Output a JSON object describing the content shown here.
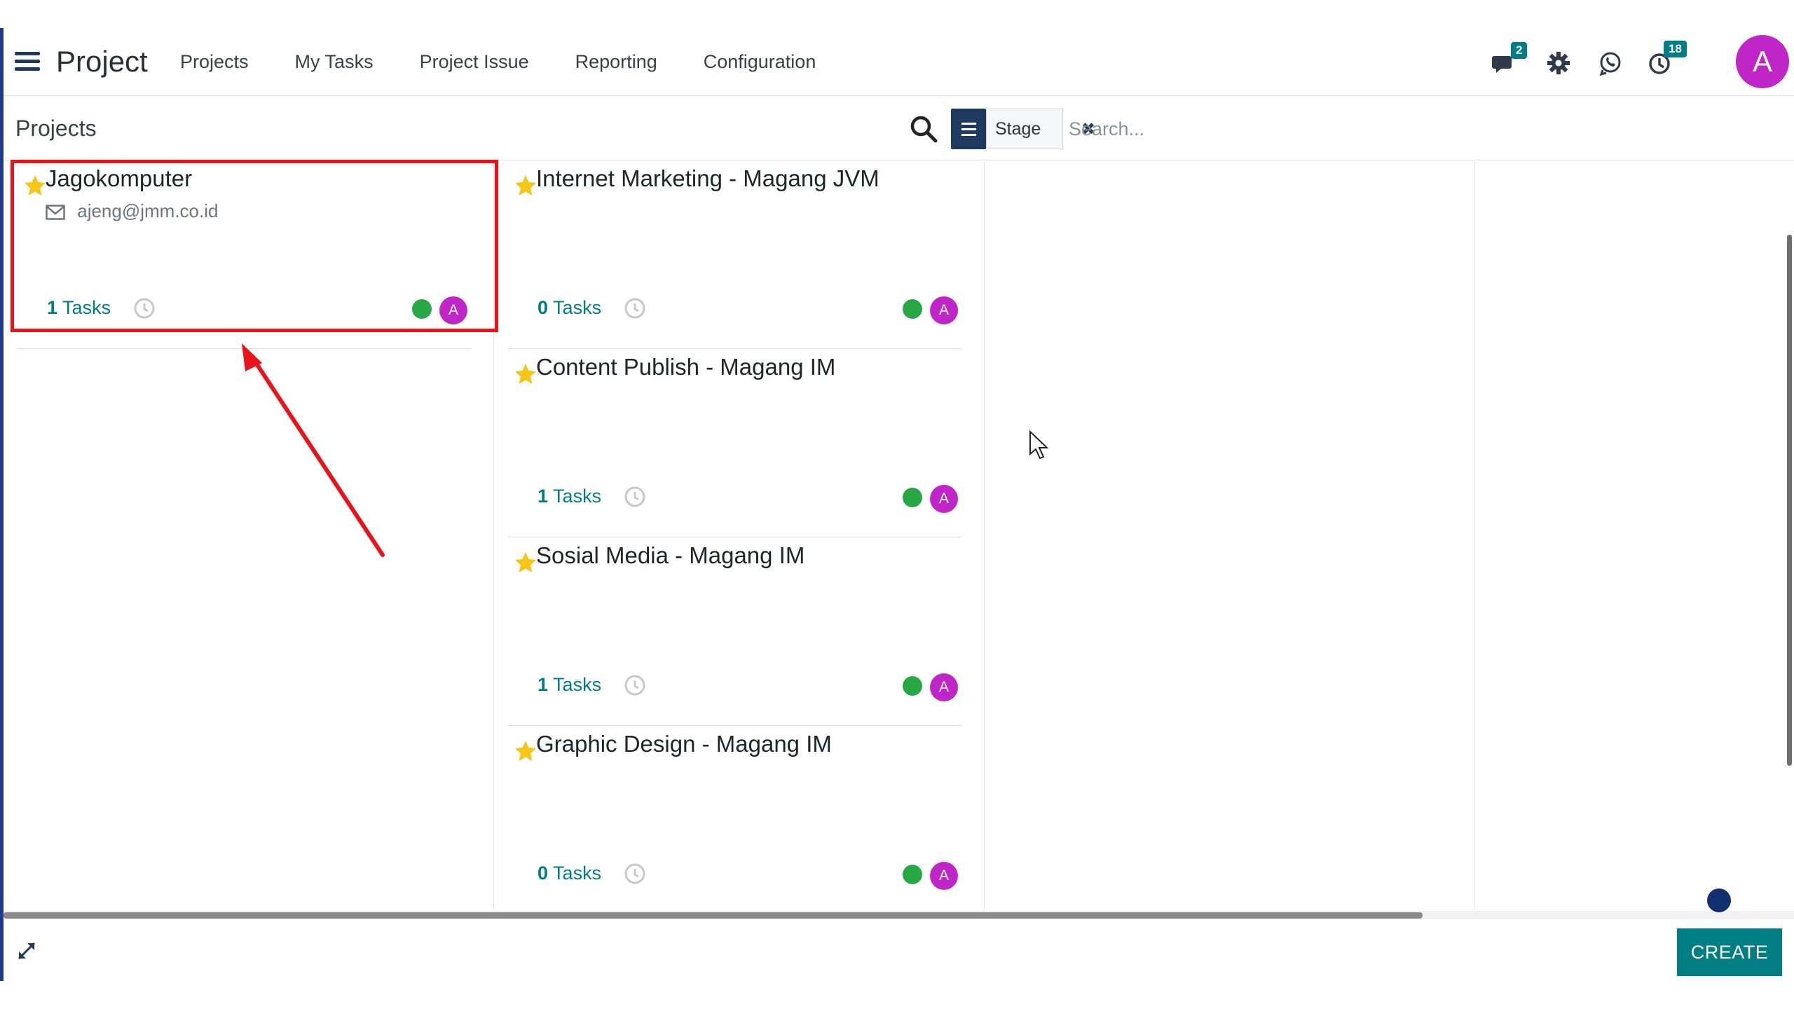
{
  "navbar": {
    "app_title": "Project",
    "menu": [
      "Projects",
      "My Tasks",
      "Project Issue",
      "Reporting",
      "Configuration"
    ],
    "messages_badge": "2",
    "activities_badge": "18",
    "user_initial": "A"
  },
  "control": {
    "breadcrumb": "Projects",
    "facet_label": "Stage",
    "search_placeholder": "Search..."
  },
  "columns": [
    {
      "cards": [
        {
          "title": "Jagokomputer",
          "email": "ajeng@jmm.co.id",
          "task_count": "1",
          "task_label": "Tasks",
          "user_initial": "A"
        }
      ]
    },
    {
      "cards": [
        {
          "title": "Internet Marketing - Magang JVM",
          "task_count": "0",
          "task_label": "Tasks",
          "user_initial": "A"
        },
        {
          "title": "Content Publish - Magang IM",
          "task_count": "1",
          "task_label": "Tasks",
          "user_initial": "A"
        },
        {
          "title": "Sosial Media - Magang IM",
          "task_count": "1",
          "task_label": "Tasks",
          "user_initial": "A"
        },
        {
          "title": "Graphic Design - Magang IM",
          "task_count": "0",
          "task_label": "Tasks",
          "user_initial": "A"
        }
      ]
    },
    {
      "cards": []
    },
    {
      "cards": []
    }
  ],
  "footer": {
    "create_label": "CREATE"
  },
  "colors": {
    "accent": "#017e84",
    "navy": "#1f3a5f",
    "avatar": "#c026c7",
    "status_green": "#28a745",
    "favorite_star": "#f5c518",
    "highlight_red": "#e8141c"
  }
}
